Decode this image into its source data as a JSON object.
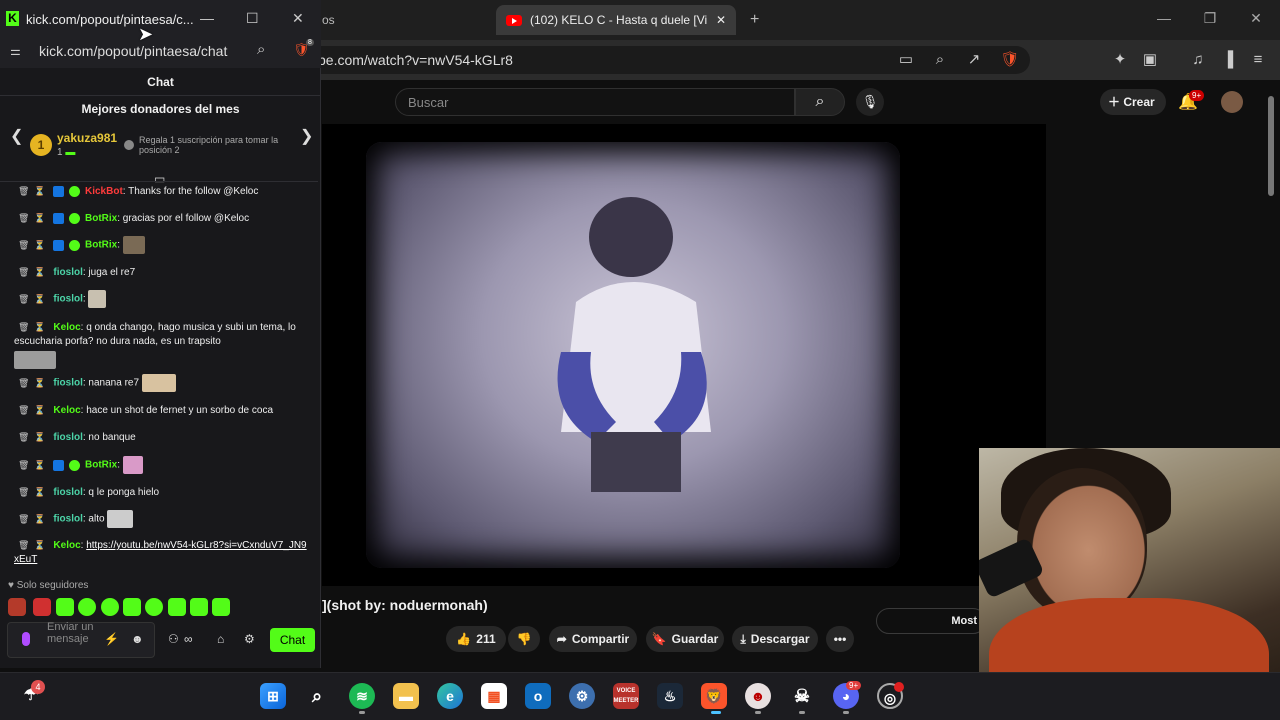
{
  "browser": {
    "bg_tab_partial": "os",
    "active_tab_title": "(102) KELO C - Hasta q duele [Vi",
    "address_url": "be.com/watch?v=nwV54-kGLr8",
    "window_controls": {
      "minimize": "—",
      "maximize": "❐",
      "close": "✕"
    },
    "new_tab": "+"
  },
  "youtube": {
    "search_placeholder": "Buscar",
    "create_label": "Crear",
    "notifications_badge": "9+",
    "video_title": "](shot by: noduermonah)",
    "likes": "211",
    "share_label": "Compartir",
    "save_label": "Guardar",
    "download_label": "Descargar",
    "more_label": "•••",
    "most_label": "Most"
  },
  "kick": {
    "window_title": "kick.com/popout/pintaesa/c...",
    "url": "kick.com/popout/pintaesa/chat",
    "extension_badge": "8",
    "chat_header": "Chat",
    "donors_title": "Mejores donadores del mes",
    "top_donor": {
      "rank": "1",
      "name": "yakuza981",
      "count": "1"
    },
    "gift_prompt": "Regala 1 suscripción para tomar la posición 2",
    "messages": [
      {
        "user": "KickBot",
        "text": ": Thanks for the follow @Keloc"
      },
      {
        "user": "BotRix",
        "text": ": gracias por el follow @Keloc"
      },
      {
        "user": "BotRix",
        "text": ":"
      },
      {
        "user": "fioslol",
        "text": ": juga el re7"
      },
      {
        "user": "fioslol",
        "text": ":"
      },
      {
        "user": "Keloc",
        "text": ": q onda chango, hago musica y subi un tema, lo escucharia porfa? no dura nada, es un trapsito"
      },
      {
        "user": "fioslol",
        "text": ": nanana re7"
      },
      {
        "user": "Keloc",
        "text": ": hace un shot de fernet y un sorbo de coca"
      },
      {
        "user": "fioslol",
        "text": ": no banque"
      },
      {
        "user": "BotRix",
        "text": ":"
      },
      {
        "user": "fioslol",
        "text": ": q le ponga hielo"
      },
      {
        "user": "fioslol",
        "text": ": alto"
      },
      {
        "user": "Keloc",
        "text": ":",
        "link": "https://youtu.be/nwV54-kGLr8?si=vCxnduV7_JN9xEuT"
      }
    ],
    "followers_only": "Solo seguidores",
    "input_placeholder": "Enviar un mensaje",
    "send_label": "Chat"
  },
  "taskbar": {
    "weather_badge": "4",
    "voicemeeter_label": "VOICE MEETER",
    "discord_badge": "9+"
  },
  "colors": {
    "kick_green": "#53fc18",
    "youtube_red": "#ff0000",
    "gold": "#e6c73a"
  }
}
